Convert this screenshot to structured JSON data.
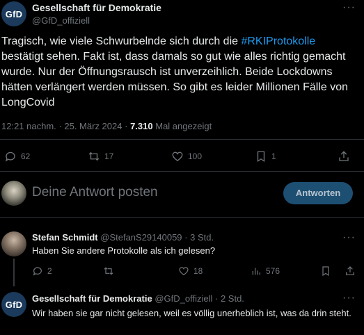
{
  "main_tweet": {
    "avatar_text": "GfD",
    "author_name": "Gesellschaft für Demokratie",
    "author_handle": "@GfD_offiziell",
    "text_before": "Tragisch, wie viele Schwurbelnde sich durch die ",
    "hashtag": "#RKIProtokolle",
    "text_after": " bestätigt sehen. Fakt ist, dass damals so gut wie alles richtig gemacht wurde. Nur der Öffnungsrausch ist unverzeihlich. Beide Lockdowns hätten verlängert werden müssen. So gibt es leider Millionen Fälle von LongCovid",
    "time": "12:21 nachm.",
    "sep": "·",
    "date": "25. März 2024",
    "views": "7.310",
    "views_label": "Mal angezeigt",
    "actions": {
      "replies": "62",
      "retweets": "17",
      "likes": "100",
      "bookmarks": "1"
    }
  },
  "composer": {
    "placeholder": "Deine Antwort posten",
    "button_label": "Antworten"
  },
  "replies": [
    {
      "author_name": "Stefan Schmidt",
      "author_handle": "@StefanS29140059",
      "time": "3 Std.",
      "text": "Haben Sie andere Protokolle als ich gelesen?",
      "replies": "2",
      "retweets": "",
      "likes": "18",
      "views": "576"
    },
    {
      "avatar_text": "GfD",
      "author_name": "Gesellschaft für Demokratie",
      "author_handle": "@GfD_offiziell",
      "time": "2 Std.",
      "text": "Wir haben sie gar nicht gelesen, weil es völlig unerheblich ist, was da drin steht."
    }
  ],
  "colors": {
    "background": "#000000",
    "text": "#e7e9ea",
    "muted": "#71767b",
    "accent": "#1d9bf0",
    "button": "#1d4f73"
  }
}
